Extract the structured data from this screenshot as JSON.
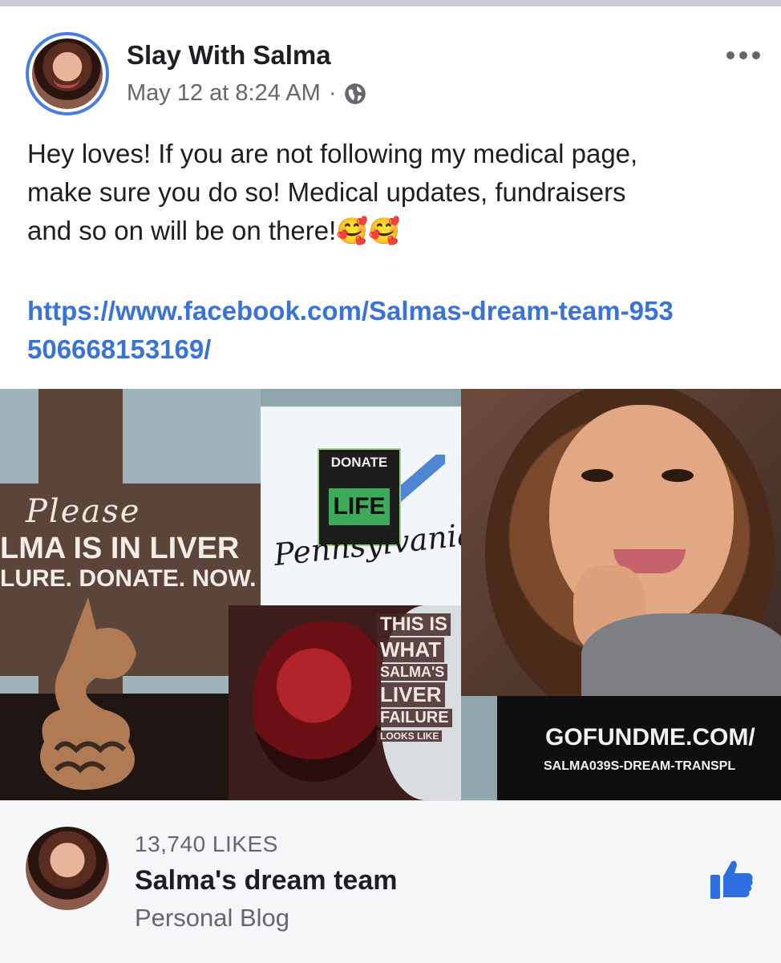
{
  "post": {
    "author": "Slay With Salma",
    "timestamp": "May 12 at 8:24 AM",
    "separator": "·",
    "privacy_icon": "globe-icon",
    "more_icon": "more-horizontal-icon",
    "text_lines": [
      "Hey loves! If you are not following my medical page,",
      "make sure you do so! Medical updates, fundraisers",
      "and so on will be on there!"
    ],
    "emojis": "🥰🥰",
    "link": "https://www.facebook.com/Salmas-dream-team-953506668153169/"
  },
  "image": {
    "please": "Please",
    "liver_line1": "LMA IS IN LIVER",
    "liver_line2": "LURE. DONATE. NOW.",
    "donate": "DONATE",
    "life": "LIFE",
    "pennsylvania": "Pennsylvania",
    "wound_lines": [
      "THIS IS",
      "WHAT",
      "SALMA'S",
      "LIVER",
      "FAILURE",
      "LOOKS LIKE"
    ],
    "gofundme_main": "GOFUNDME.COM/",
    "gofundme_sub": "SALMA039S-DREAM-TRANSPL"
  },
  "page_card": {
    "likes": "13,740 LIKES",
    "name": "Salma's dream team",
    "category": "Personal Blog",
    "like_icon": "thumbs-up-icon"
  },
  "colors": {
    "link": "#3a73d6",
    "avatar_ring": "#4a7be0",
    "like_icon": "#2d6fe0"
  }
}
